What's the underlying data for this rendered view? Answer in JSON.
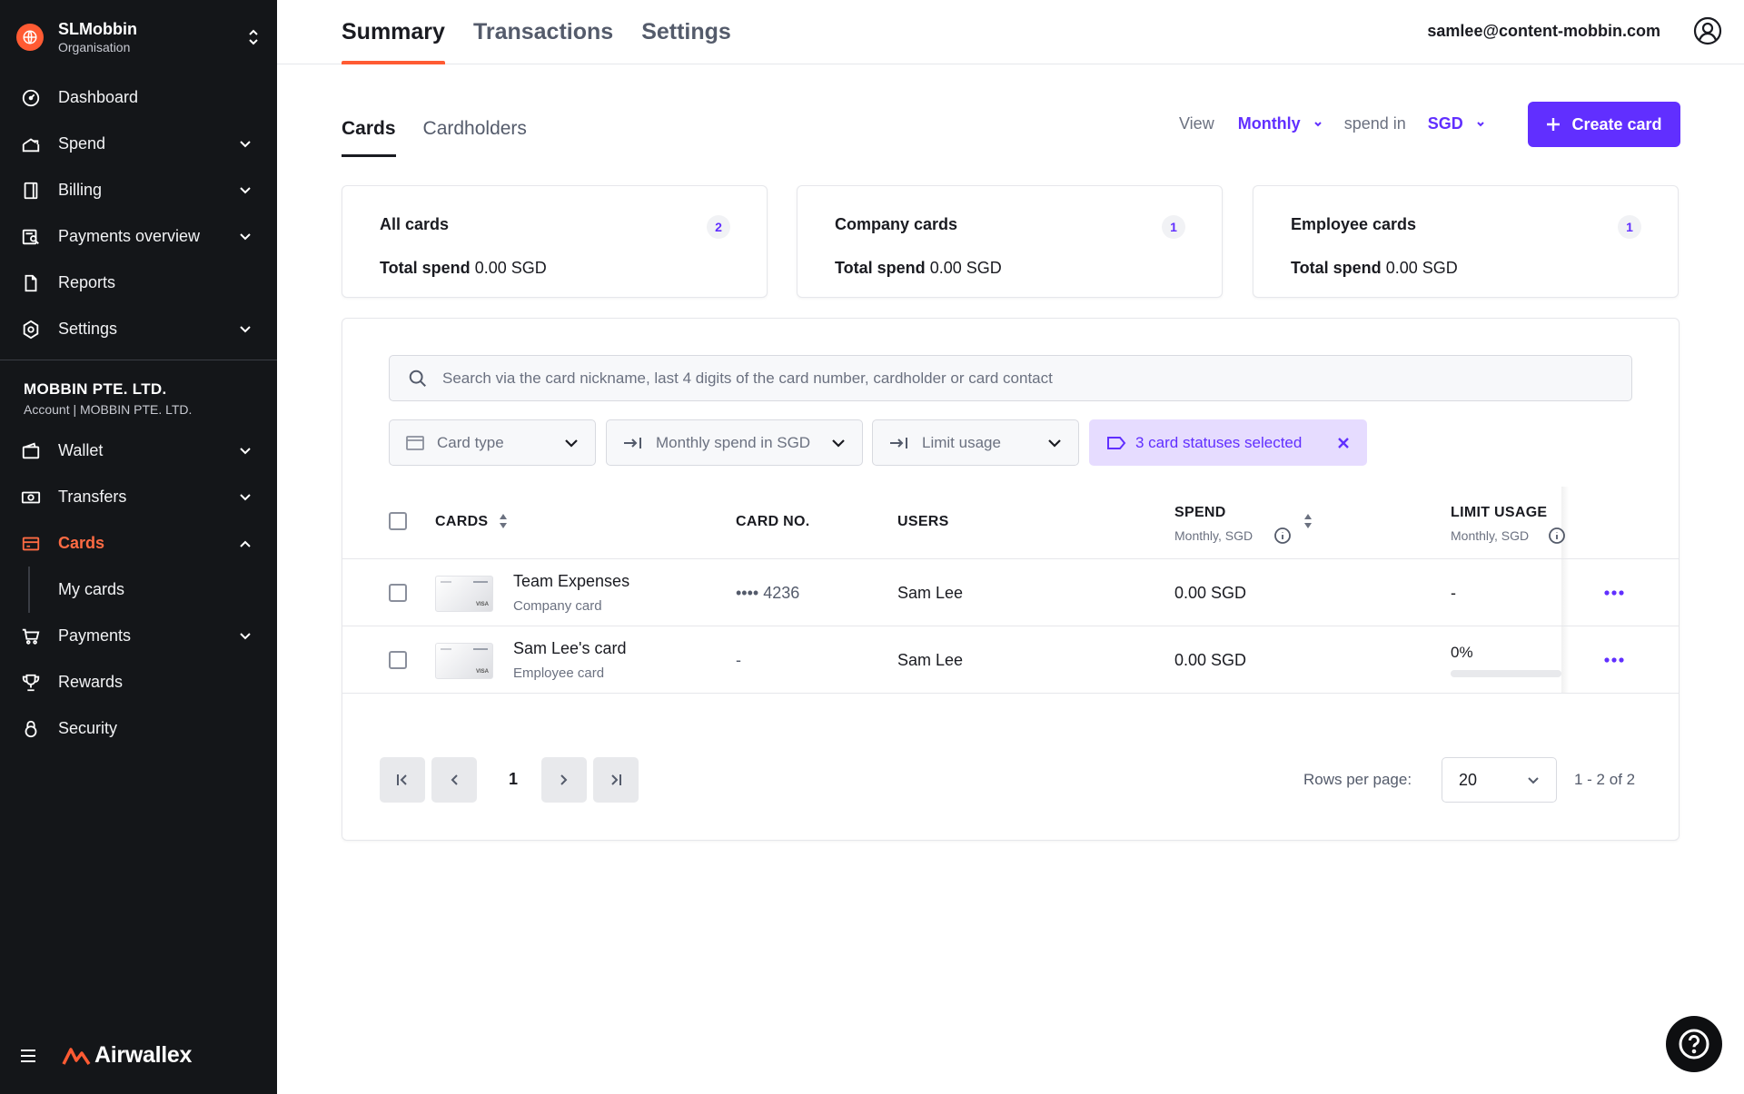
{
  "org": {
    "name": "SLMobbin",
    "sub": "Organisation"
  },
  "nav_top": [
    {
      "label": "Dashboard",
      "has_chevron": false
    },
    {
      "label": "Spend",
      "has_chevron": true
    },
    {
      "label": "Billing",
      "has_chevron": true
    },
    {
      "label": "Payments overview",
      "has_chevron": true
    },
    {
      "label": "Reports",
      "has_chevron": false
    },
    {
      "label": "Settings",
      "has_chevron": true
    }
  ],
  "company": {
    "name": "MOBBIN PTE. LTD.",
    "sub": "Account | MOBBIN PTE. LTD."
  },
  "nav_account": [
    {
      "label": "Wallet"
    },
    {
      "label": "Transfers"
    },
    {
      "label": "Cards"
    },
    {
      "label": "My cards"
    },
    {
      "label": "Payments"
    },
    {
      "label": "Rewards"
    },
    {
      "label": "Security"
    }
  ],
  "brand": "Airwallex",
  "top_tabs": [
    "Summary",
    "Transactions",
    "Settings"
  ],
  "user_email": "samlee@content-mobbin.com",
  "sub_tabs": [
    "Cards",
    "Cardholders"
  ],
  "view": {
    "label": "View",
    "period": "Monthly",
    "spend_in": "spend in",
    "currency": "SGD"
  },
  "create_button": "Create card",
  "summary_cards": [
    {
      "title": "All cards",
      "count": "2",
      "total_label": "Total spend",
      "total_value": "0.00 SGD"
    },
    {
      "title": "Company cards",
      "count": "1",
      "total_label": "Total spend",
      "total_value": "0.00 SGD"
    },
    {
      "title": "Employee cards",
      "count": "1",
      "total_label": "Total spend",
      "total_value": "0.00 SGD"
    }
  ],
  "search": {
    "placeholder": "Search via the card nickname, last 4 digits of the card number, cardholder or card contact",
    "value": ""
  },
  "filters": {
    "card_type": "Card type",
    "monthly_spend": "Monthly spend in SGD",
    "limit_usage": "Limit usage",
    "statuses": "3 card statuses selected"
  },
  "table": {
    "headers": {
      "cards": "CARDS",
      "card_no": "CARD NO.",
      "users": "USERS",
      "spend": "SPEND",
      "spend_sub": "Monthly, SGD",
      "limit": "LIMIT USAGE",
      "limit_sub": "Monthly, SGD"
    },
    "rows": [
      {
        "name": "Team Expenses",
        "type": "Company card",
        "card_no": "•••• 4236",
        "user": "Sam Lee",
        "spend": "0.00 SGD",
        "limit": "-",
        "limit_fraction": null
      },
      {
        "name": "Sam Lee's card",
        "type": "Employee card",
        "card_no": "-",
        "user": "Sam Lee",
        "spend": "0.00 SGD",
        "limit": "0%",
        "limit_fraction": 0
      }
    ]
  },
  "pagination": {
    "page": "1",
    "rows_label": "Rows per page:",
    "rows_value": "20",
    "range": "1 - 2 of 2"
  },
  "colors": {
    "accent": "#612fff",
    "brand": "#ff5b33",
    "sidebar": "#141619"
  }
}
